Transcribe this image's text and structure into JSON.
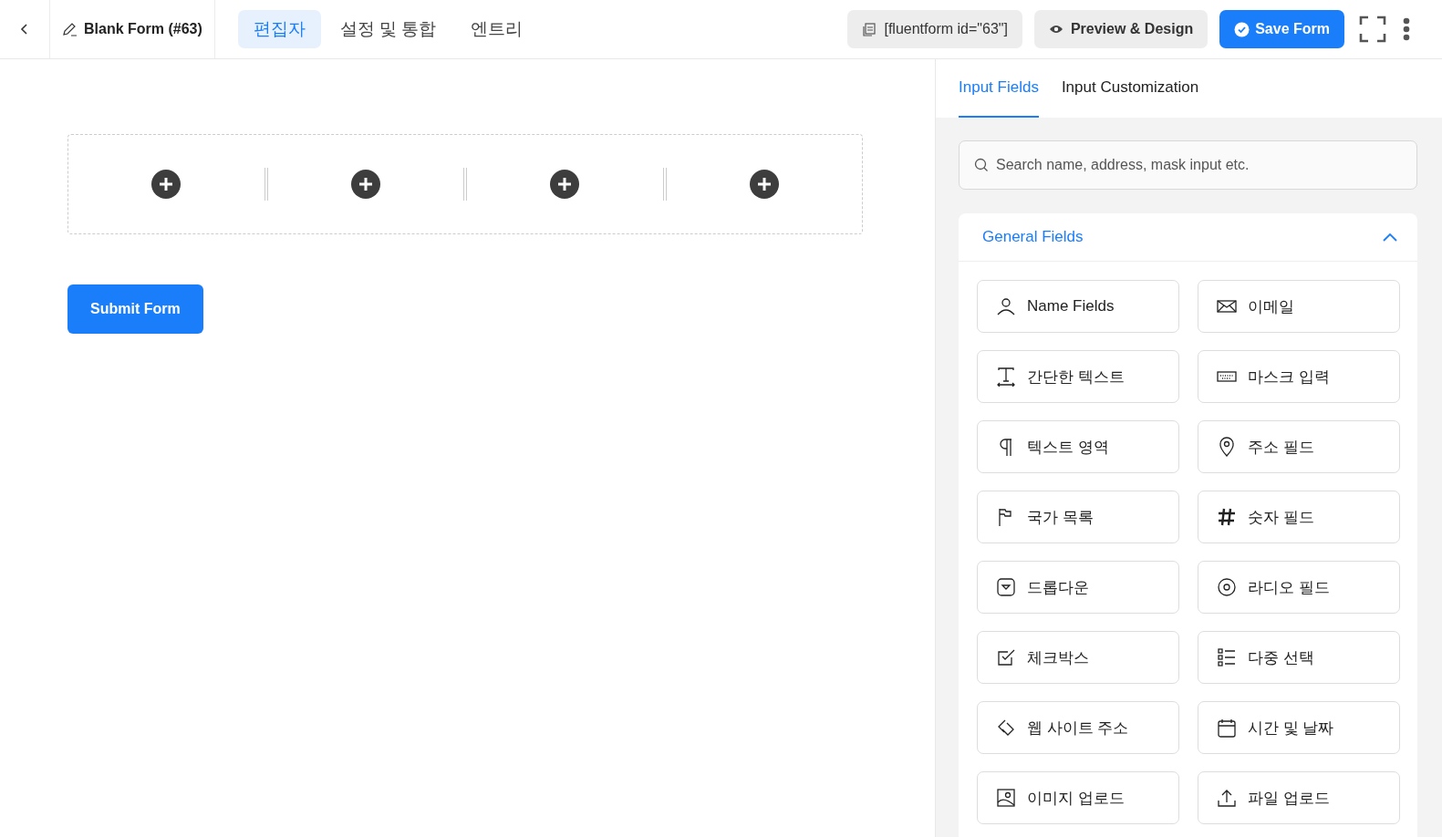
{
  "header": {
    "form_title": "Blank Form (#63)",
    "tabs": [
      {
        "label": "편집자",
        "selected": true
      },
      {
        "label": "설정 및 통합",
        "selected": false
      },
      {
        "label": "엔트리",
        "selected": false
      }
    ],
    "shortcode": "[fluentform id=\"63\"]",
    "preview_label": "Preview & Design",
    "save_label": "Save Form"
  },
  "editor": {
    "submit_label": "Submit Form"
  },
  "sidebar": {
    "tabs": [
      {
        "label": "Input Fields",
        "selected": true
      },
      {
        "label": "Input Customization",
        "selected": false
      }
    ],
    "search": {
      "placeholder": "Search name, address, mask input etc."
    },
    "section": {
      "title": "General Fields",
      "expanded": true,
      "fields": [
        {
          "label": "Name Fields",
          "kind": "person"
        },
        {
          "label": "이메일",
          "kind": "mail"
        },
        {
          "label": "간단한 텍스트",
          "kind": "text"
        },
        {
          "label": "마스크 입력",
          "kind": "keyboard"
        },
        {
          "label": "텍스트 영역",
          "kind": "paragraph"
        },
        {
          "label": "주소 필드",
          "kind": "pin"
        },
        {
          "label": "국가 목록",
          "kind": "flag"
        },
        {
          "label": "숫자 필드",
          "kind": "hash"
        },
        {
          "label": "드롭다운",
          "kind": "dropdown"
        },
        {
          "label": "라디오 필드",
          "kind": "radio"
        },
        {
          "label": "체크박스",
          "kind": "checkbox"
        },
        {
          "label": "다중 선택",
          "kind": "list"
        },
        {
          "label": "웹 사이트 주소",
          "kind": "link"
        },
        {
          "label": "시간 및 날짜",
          "kind": "calendar"
        },
        {
          "label": "이미지 업로드",
          "kind": "image"
        },
        {
          "label": "파일 업로드",
          "kind": "upload"
        }
      ]
    }
  }
}
